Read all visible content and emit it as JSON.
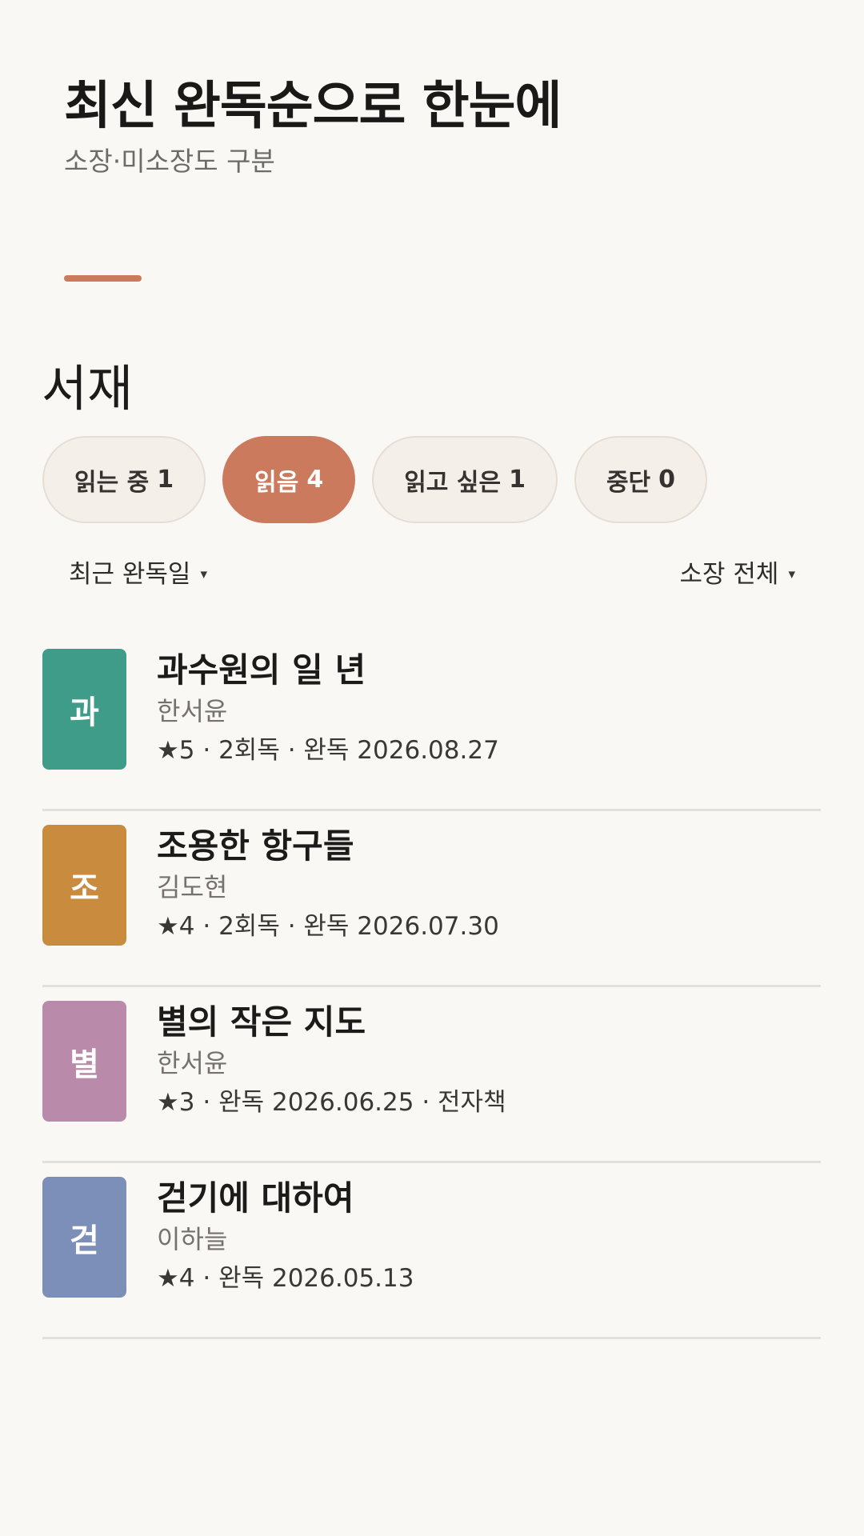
{
  "header": {
    "title": "최신 완독순으로 한눈에",
    "subtitle": "소장·미소장도 구분"
  },
  "colors": {
    "background": "#faf8f5",
    "accent": "#cc7a5d",
    "chip_bg": "#f4efe9",
    "divider": "#e3e0dc"
  },
  "section": {
    "title": "서재"
  },
  "filters": [
    {
      "label": "읽는 중",
      "count": "1",
      "active": false
    },
    {
      "label": "읽음",
      "count": "4",
      "active": true
    },
    {
      "label": "읽고 싶은",
      "count": "1",
      "active": false
    },
    {
      "label": "중단",
      "count": "0",
      "active": false
    }
  ],
  "sort": {
    "order_label": "최근 완독일",
    "ownership_label": "소장 전체",
    "caret": "▾",
    "caret_icon": "caret-down-icon"
  },
  "books": [
    {
      "initial": "과",
      "title": "과수원의 일 년",
      "author": "한서윤",
      "meta": "★5 · 2회독 · 완독 2026.08.27",
      "cover_color": "#3f9c89"
    },
    {
      "initial": "조",
      "title": "조용한 항구들",
      "author": "김도현",
      "meta": "★4 · 2회독 · 완독 2026.07.30",
      "cover_color": "#c98b3d"
    },
    {
      "initial": "별",
      "title": "별의 작은 지도",
      "author": "한서윤",
      "meta": "★3 · 완독 2026.06.25 · 전자책",
      "cover_color": "#b98aaa"
    },
    {
      "initial": "걷",
      "title": "걷기에 대하여",
      "author": "이하늘",
      "meta": "★4 · 완독 2026.05.13",
      "cover_color": "#7b8fb8"
    }
  ]
}
